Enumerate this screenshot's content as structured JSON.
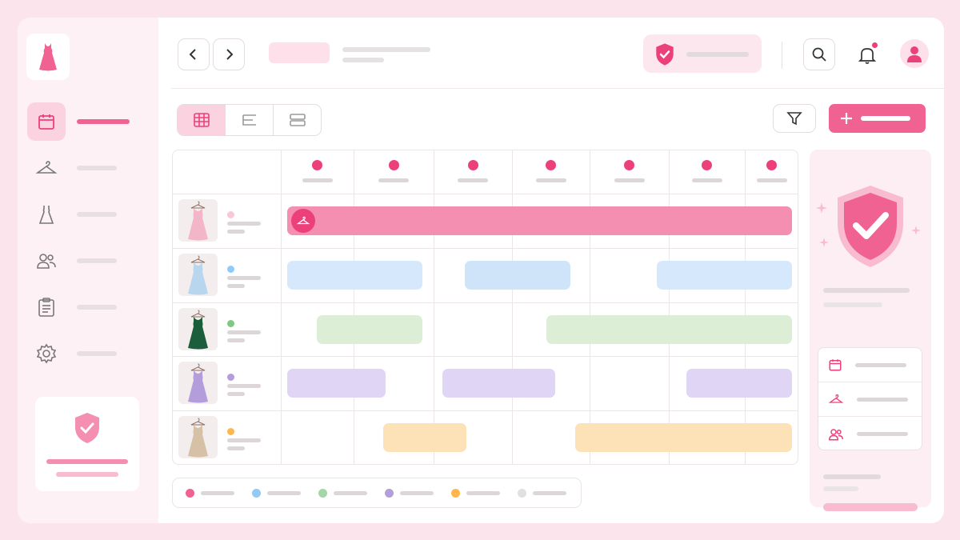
{
  "colors": {
    "accent": "#f06292",
    "pink": "#f48fb1",
    "blue": "#bbdefb",
    "green": "#c8e6c9",
    "purple": "#d1c4e9",
    "yellow": "#ffe0b2",
    "gray": "#e0e0e0"
  },
  "sidebar": {
    "logo_icon": "dress-icon",
    "items": [
      {
        "icon": "calendar-icon",
        "active": true
      },
      {
        "icon": "hanger-icon",
        "active": false
      },
      {
        "icon": "dress-outline-icon",
        "active": false
      },
      {
        "icon": "users-icon",
        "active": false
      },
      {
        "icon": "clipboard-icon",
        "active": false
      },
      {
        "icon": "gear-icon",
        "active": false
      }
    ],
    "card_icon": "shield-check-icon"
  },
  "header": {
    "back_icon": "chevron-left-icon",
    "forward_icon": "chevron-right-icon",
    "status_icon": "shield-check-icon",
    "search_icon": "search-icon",
    "notification_icon": "bell-icon",
    "notification_badge": true,
    "avatar_icon": "user-icon"
  },
  "toolbar": {
    "views": [
      "grid-view-icon",
      "list-view-icon",
      "rows-view-icon"
    ],
    "active_view": 0,
    "filter_icon": "filter-icon",
    "add_icon": "plus-icon"
  },
  "schedule": {
    "columns": 7,
    "rows": [
      {
        "dress_color": "#f3b6c9",
        "dot": "#f8c8d8",
        "bookings": [
          {
            "start": 0,
            "end": 7,
            "color": "#f48fb1",
            "icon": "hanger-icon"
          }
        ]
      },
      {
        "dress_color": "#b9d6ef",
        "dot": "#90caf9",
        "bookings": [
          {
            "start": 0,
            "end": 2,
            "color": "#d6e8fb"
          },
          {
            "start": 2.4,
            "end": 4,
            "color": "#cfe3f9"
          },
          {
            "start": 5,
            "end": 7,
            "color": "#d6e8fb"
          }
        ]
      },
      {
        "dress_color": "#1b5e3b",
        "dot": "#81c784",
        "bookings": [
          {
            "start": 0.4,
            "end": 2,
            "color": "#dcefd6"
          },
          {
            "start": 3.5,
            "end": 7,
            "color": "#dcefd6"
          }
        ]
      },
      {
        "dress_color": "#b39ddb",
        "dot": "#b39ddb",
        "bookings": [
          {
            "start": 0,
            "end": 1.5,
            "color": "#e0d5f5"
          },
          {
            "start": 2.1,
            "end": 3.8,
            "color": "#e0d5f5"
          },
          {
            "start": 5.4,
            "end": 7,
            "color": "#e0d5f5"
          }
        ]
      },
      {
        "dress_color": "#d7c1a6",
        "dot": "#ffb74d",
        "bookings": [
          {
            "start": 1.3,
            "end": 2.6,
            "color": "#fde2b8"
          },
          {
            "start": 3.9,
            "end": 7,
            "color": "#fde2b8"
          }
        ]
      }
    ]
  },
  "legend": [
    "#f06292",
    "#90caf9",
    "#a5d6a7",
    "#b39ddb",
    "#ffb74d",
    "#e0e0e0"
  ],
  "right_panel": {
    "hero_icon": "shield-check-icon",
    "rows": [
      "calendar-icon",
      "hanger-icon",
      "users-icon"
    ]
  }
}
